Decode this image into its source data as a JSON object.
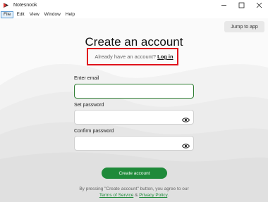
{
  "window": {
    "title": "Notesnook",
    "controls": [
      "minimize",
      "maximize",
      "close"
    ]
  },
  "menu": [
    "File",
    "Edit",
    "View",
    "Window",
    "Help"
  ],
  "jump_to_app": "Jump to app",
  "heading": "Create an account",
  "login_prompt": {
    "text": "Already have an account?",
    "link": "Log in"
  },
  "email": {
    "label": "Enter email",
    "value": ""
  },
  "password": {
    "label": "Set password",
    "value": ""
  },
  "confirm_password": {
    "label": "Confirm password",
    "value": ""
  },
  "create_button": "Create account",
  "terms": {
    "line1": "By pressing \"Create account\" button, you agree to our",
    "tos": "Terms of Service",
    "amp": "&",
    "privacy": "Privacy Policy",
    "end": "."
  },
  "colors": {
    "accent": "#1f8a3a",
    "highlight_box": "#e0131c"
  }
}
